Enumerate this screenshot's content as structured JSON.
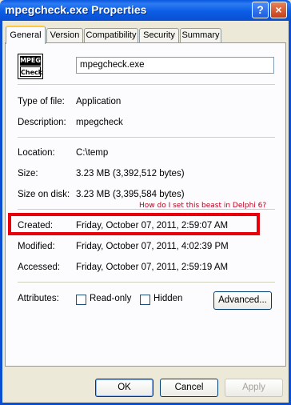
{
  "window": {
    "title": "mpegcheck.exe Properties",
    "help_glyph": "?",
    "close_glyph": "×"
  },
  "tabs": [
    {
      "label": "General",
      "active": true
    },
    {
      "label": "Version",
      "active": false
    },
    {
      "label": "Compatibility",
      "active": false
    },
    {
      "label": "Security",
      "active": false
    },
    {
      "label": "Summary",
      "active": false
    }
  ],
  "file": {
    "icon": "mpeg-check-file-icon",
    "icon_top": "MPEG",
    "icon_bottom": "Check",
    "name": "mpegcheck.exe"
  },
  "details": {
    "type_label": "Type of file:",
    "type_value": "Application",
    "description_label": "Description:",
    "description_value": "mpegcheck",
    "location_label": "Location:",
    "location_value": "C:\\temp",
    "size_label": "Size:",
    "size_value": "3.23 MB (3,392,512 bytes)",
    "size_on_disk_label": "Size on disk:",
    "size_on_disk_value": "3.23 MB (3,395,584 bytes)",
    "created_label": "Created:",
    "created_value": "Friday, October 07, 2011, 2:59:07 AM",
    "modified_label": "Modified:",
    "modified_value": "Friday, October 07, 2011, 4:02:39 PM",
    "accessed_label": "Accessed:",
    "accessed_value": "Friday, October 07, 2011, 2:59:19 AM"
  },
  "annotation": {
    "text": "How do I set this beast in Delphi 6?",
    "color": "#C0001E",
    "highlight_color": "#E8000B"
  },
  "attributes": {
    "label": "Attributes:",
    "readonly_label": "Read-only",
    "readonly_checked": false,
    "hidden_label": "Hidden",
    "hidden_checked": false,
    "advanced_label": "Advanced..."
  },
  "buttons": {
    "ok": "OK",
    "cancel": "Cancel",
    "apply": "Apply"
  },
  "colors": {
    "title_bar": "#0A58DF",
    "dialog_bg": "#ECE9D8",
    "active_tab_accent": "#FFC83C"
  }
}
